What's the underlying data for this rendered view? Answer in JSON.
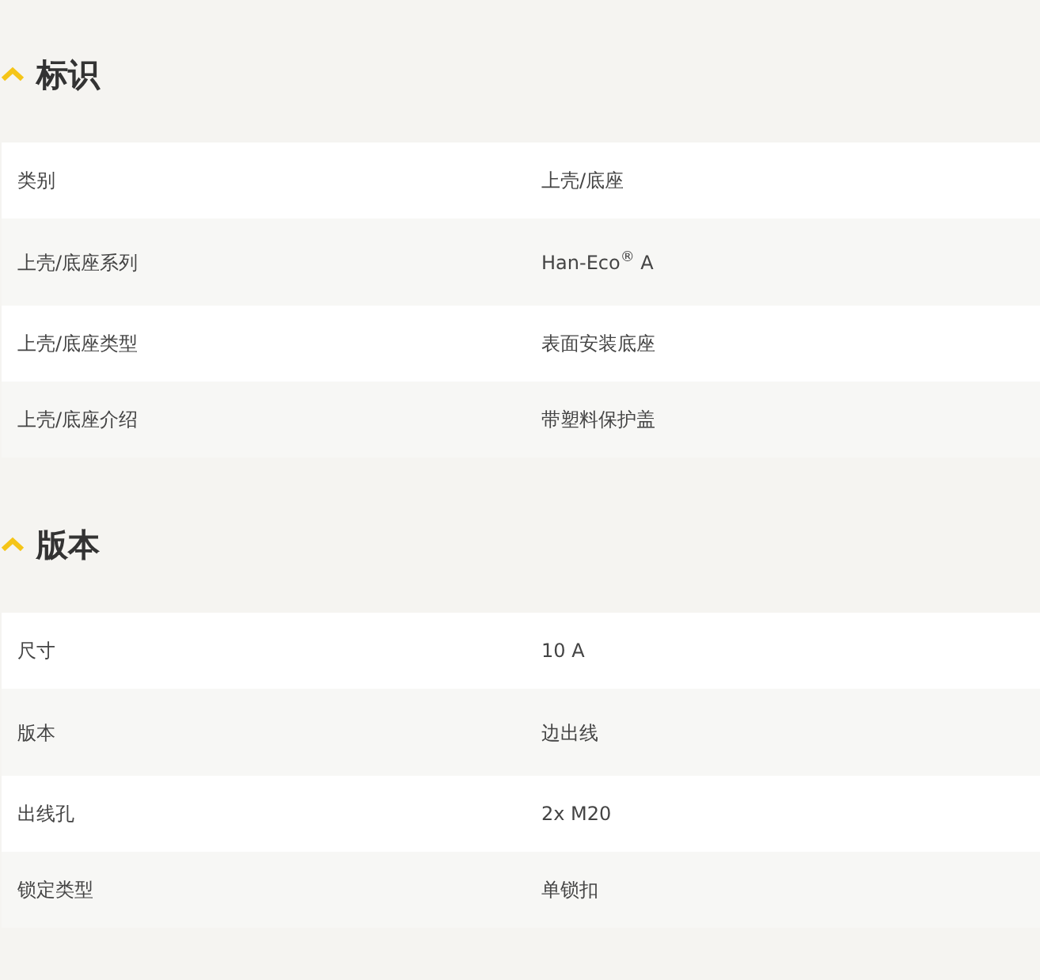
{
  "sections": [
    {
      "title": "标识",
      "expanded": true,
      "rows": [
        {
          "label": "类别",
          "value": "上壳/底座"
        },
        {
          "label": "上壳/底座系列",
          "value": "Han-Eco$^{®}$ A"
        },
        {
          "label": "上壳/底座类型",
          "value": "表面安装底座"
        },
        {
          "label": "上壳/底座介绍",
          "value": "带塑料保护盖"
        }
      ]
    },
    {
      "title": "版本",
      "expanded": true,
      "rows": [
        {
          "label": "尺寸",
          "value": "10 A"
        },
        {
          "label": "版本",
          "value": "边出线"
        },
        {
          "label": "出线孔",
          "value": "2x M20"
        },
        {
          "label": "锁定类型",
          "value": "单锁扣"
        }
      ]
    }
  ]
}
